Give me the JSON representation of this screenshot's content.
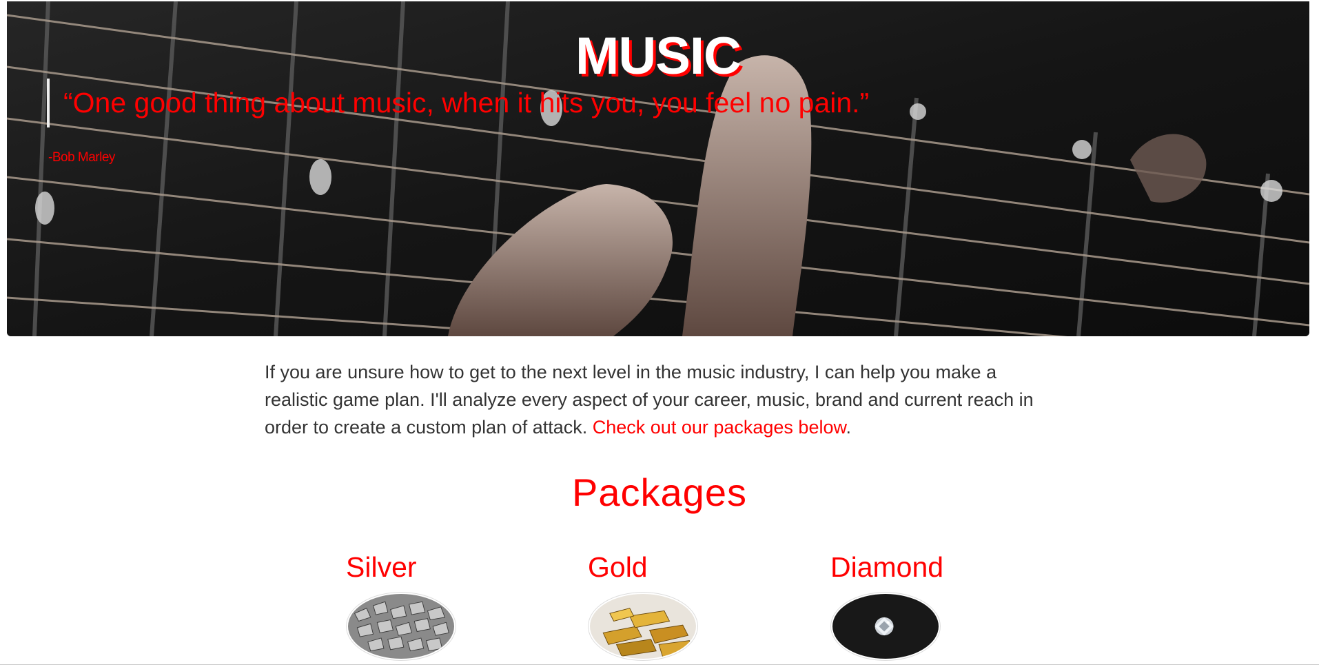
{
  "hero": {
    "title": "MUSIC",
    "quote": "“One good thing about music, when it hits you, you feel no pain.”",
    "author": "-Bob Marley",
    "image": "guitar-fretboard-photo"
  },
  "intro": {
    "text": "If you are unsure how to get to the next level in the music industry, I can help you make a realistic game plan. I'll analyze every aspect of your career, music, brand and current reach in order to create a custom plan of attack. ",
    "link_text": "Check out our packages below",
    "trailing": "."
  },
  "packages": {
    "heading": "Packages",
    "items": [
      {
        "name": "Silver",
        "image": "silver-pieces-photo"
      },
      {
        "name": "Gold",
        "image": "gold-bars-photo"
      },
      {
        "name": "Diamond",
        "image": "diamond-photo"
      }
    ]
  },
  "colors": {
    "accent": "#ff0000",
    "text": "#333333",
    "hero_bg": "#141414"
  }
}
